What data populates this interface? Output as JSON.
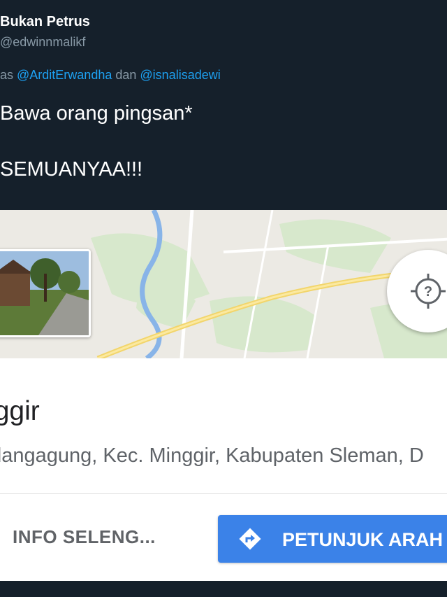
{
  "tweet": {
    "author_name": "Bukan Petrus",
    "author_handle": "@edwinnmalikf",
    "reply_prefix": "as ",
    "reply_user_1": "@ArditErwandha",
    "reply_connector": " dan ",
    "reply_user_2": "@isnalisadewi",
    "text": "Bawa orang pingsan*\n\nSEMUANYAA!!!"
  },
  "map_card": {
    "place_title": "nggir",
    "place_address": "ndangagung, Kec. Minggir, Kabupaten Sleman, D",
    "info_button_label": "INFO SELENG...",
    "directions_button_label": "PETUNJUK ARAH",
    "locate_icon": "crosshair-question-icon",
    "directions_icon": "directions-arrow-icon"
  },
  "colors": {
    "background": "#15202b",
    "link": "#1da1f2",
    "directions_button": "#3b82e8"
  }
}
